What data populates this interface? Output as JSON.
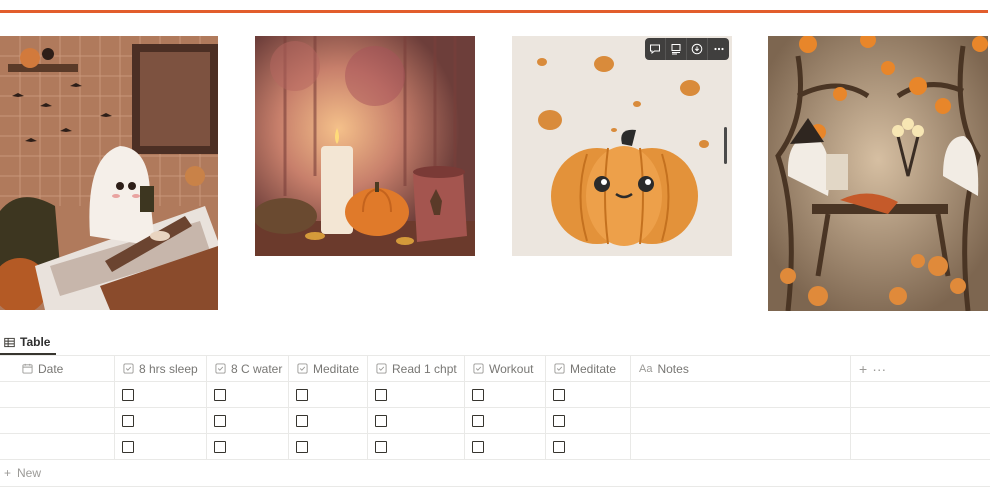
{
  "accent_color": "#e25d2c",
  "gallery": {
    "images": [
      {
        "name": "ghost-bath-illustration"
      },
      {
        "name": "candle-pumpkin-mug-illustration"
      },
      {
        "name": "smiling-pumpkin-illustration"
      },
      {
        "name": "ghost-tea-party-illustration"
      }
    ],
    "toolbar_icons": [
      "comment-icon",
      "caption-icon",
      "download-icon",
      "more-icon"
    ]
  },
  "view_tab": {
    "icon": "table-icon",
    "label": "Table"
  },
  "table": {
    "columns": [
      {
        "label": "Date",
        "icon": "calendar-icon"
      },
      {
        "label": "8 hrs sleep",
        "icon": "checkbox-type-icon"
      },
      {
        "label": "8 C water",
        "icon": "checkbox-type-icon"
      },
      {
        "label": "Meditate",
        "icon": "checkbox-type-icon"
      },
      {
        "label": "Read 1 chpt",
        "icon": "checkbox-type-icon"
      },
      {
        "label": "Workout",
        "icon": "checkbox-type-icon"
      },
      {
        "label": "Meditate",
        "icon": "checkbox-type-icon"
      },
      {
        "label": "Notes",
        "icon": "text-type-icon",
        "icon_text": "Aa"
      }
    ],
    "add_column": "+",
    "more": "···",
    "rows": [
      {
        "date": "",
        "checks": [
          false,
          false,
          false,
          false,
          false,
          false
        ],
        "notes": ""
      },
      {
        "date": "",
        "checks": [
          false,
          false,
          false,
          false,
          false,
          false
        ],
        "notes": ""
      },
      {
        "date": "",
        "checks": [
          false,
          false,
          false,
          false,
          false,
          false
        ],
        "notes": ""
      }
    ]
  },
  "new_row": {
    "icon": "+",
    "label": "New"
  }
}
